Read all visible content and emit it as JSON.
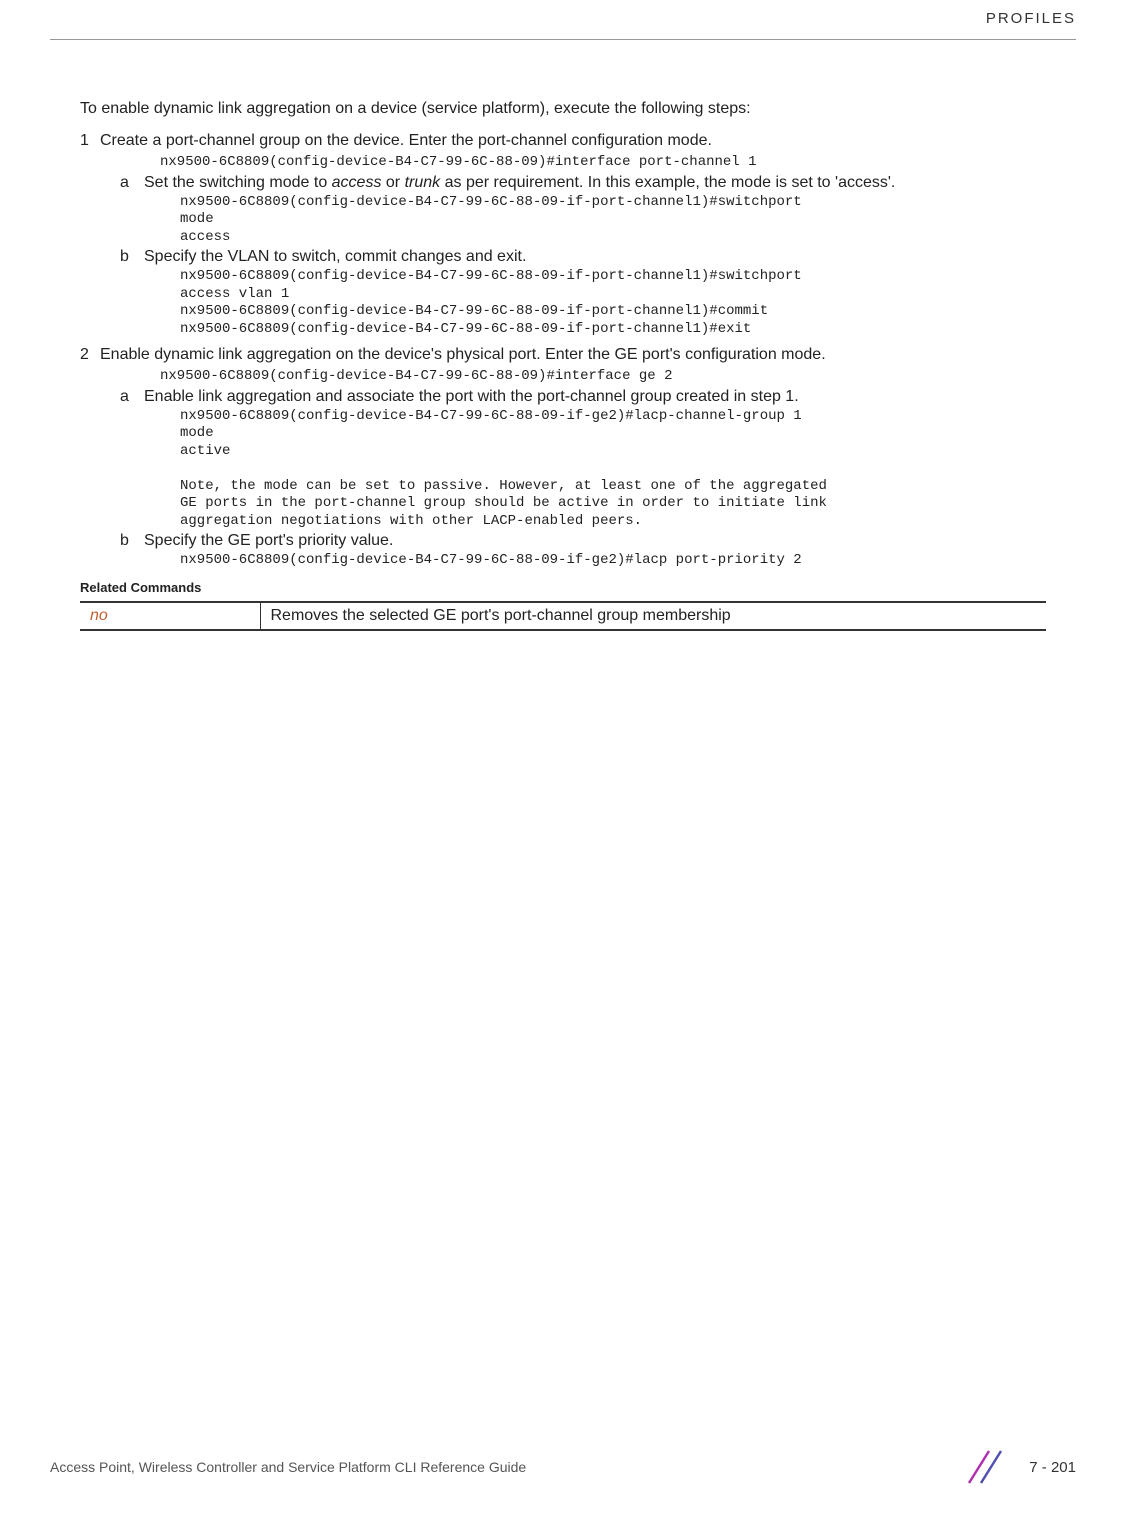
{
  "header": {
    "chapter_label": "PROFILES"
  },
  "intro": "To enable dynamic link aggregation on a device (service platform), execute the following steps:",
  "steps": [
    {
      "num": "1",
      "text_pre": "Create a port-channel group on the device. Enter the port-channel configuration mode.",
      "code1": "nx9500-6C8809(config-device-B4-C7-99-6C-88-09)#interface port-channel 1",
      "substeps": [
        {
          "letter": "a",
          "text_prefix": "Set the switching mode to ",
          "italic1": "access",
          "text_mid1": " or ",
          "italic2": "trunk",
          "text_suffix": " as per requirement. In this example, the mode is set to 'access'.",
          "code": "nx9500-6C8809(config-device-B4-C7-99-6C-88-09-if-port-channel1)#switchport\nmode\naccess"
        },
        {
          "letter": "b",
          "text": "Specify the VLAN to switch, commit changes and exit.",
          "code": "nx9500-6C8809(config-device-B4-C7-99-6C-88-09-if-port-channel1)#switchport\naccess vlan 1\nnx9500-6C8809(config-device-B4-C7-99-6C-88-09-if-port-channel1)#commit\nnx9500-6C8809(config-device-B4-C7-99-6C-88-09-if-port-channel1)#exit"
        }
      ]
    },
    {
      "num": "2",
      "text_pre": "Enable dynamic link aggregation on the device's physical port. Enter the GE port's configuration mode.",
      "code1": "nx9500-6C8809(config-device-B4-C7-99-6C-88-09)#interface ge 2",
      "substeps": [
        {
          "letter": "a",
          "text": "Enable link aggregation and associate the port with the port-channel group created in step 1.",
          "code": "nx9500-6C8809(config-device-B4-C7-99-6C-88-09-if-ge2)#lacp-channel-group 1\nmode\nactive\n\nNote, the mode can be set to passive. However, at least one of the aggregated\nGE ports in the port-channel group should be active in order to initiate link\naggregation negotiations with other LACP-enabled peers."
        },
        {
          "letter": "b",
          "text": "Specify the GE port's priority value.",
          "code": "nx9500-6C8809(config-device-B4-C7-99-6C-88-09-if-ge2)#lacp port-priority 2"
        }
      ]
    }
  ],
  "related_commands": {
    "heading": "Related Commands",
    "link": "no",
    "desc": "Removes the selected GE port's port-channel group membership"
  },
  "footer": {
    "text": "Access Point, Wireless Controller and Service Platform CLI Reference Guide",
    "page": "7 - 201"
  }
}
